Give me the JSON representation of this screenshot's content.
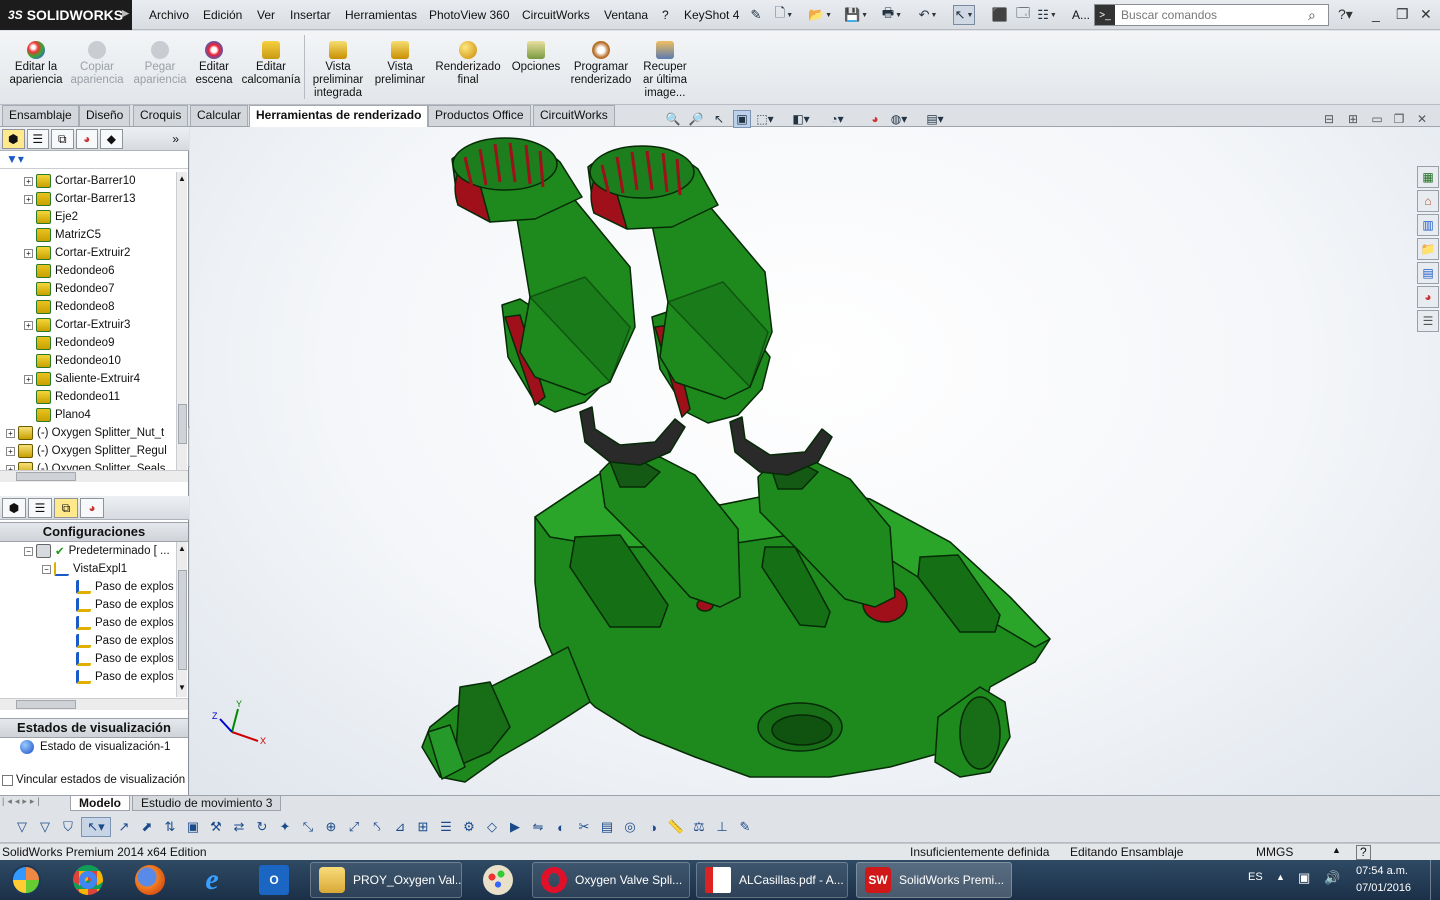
{
  "app": {
    "logo": "SOLIDWORKS",
    "logo_prefix": "3S"
  },
  "menu": [
    "Archivo",
    "Edición",
    "Ver",
    "Insertar",
    "Herramientas",
    "PhotoView 360",
    "CircuitWorks",
    "Ventana",
    "?",
    "KeyShot 4"
  ],
  "search": {
    "placeholder": "Buscar comandos",
    "truncated_label": "A..."
  },
  "ribbon": [
    {
      "label1": "Editar la",
      "label2": "apariencia",
      "label3": "",
      "disabled": false,
      "color": "#d23a2a"
    },
    {
      "label1": "Copiar",
      "label2": "apariencia",
      "label3": "",
      "disabled": true,
      "color": "#b8bcc0"
    },
    {
      "label1": "Pegar",
      "label2": "apariencia",
      "label3": "",
      "disabled": true,
      "color": "#b8bcc0"
    },
    {
      "label1": "Editar",
      "label2": "escena",
      "label3": "",
      "disabled": false,
      "color": "#3a7bd5"
    },
    {
      "label1": "Editar",
      "label2": "calcomanía",
      "label3": "",
      "disabled": false,
      "color": "#e2a400"
    },
    {
      "label1": "Vista",
      "label2": "preliminar",
      "label3": "integrada",
      "disabled": false,
      "color": "#d9a200"
    },
    {
      "label1": "Vista",
      "label2": "preliminar",
      "label3": "",
      "disabled": false,
      "color": "#d9a200"
    },
    {
      "label1": "Renderizado",
      "label2": "final",
      "label3": "",
      "disabled": false,
      "color": "#c98a00"
    },
    {
      "label1": "Opciones",
      "label2": "",
      "label3": "",
      "disabled": false,
      "color": "#7a9a40"
    },
    {
      "label1": "Programar",
      "label2": "renderizado",
      "label3": "",
      "disabled": false,
      "color": "#b7702a"
    },
    {
      "label1": "Recuper",
      "label2": "ar última",
      "label3": "image...",
      "disabled": false,
      "color": "#5a7ab0"
    }
  ],
  "tabs": [
    "Ensamblaje",
    "Diseño",
    "Croquis",
    "Calcular",
    "Herramientas de renderizado",
    "Productos Office",
    "CircuitWorks"
  ],
  "active_tab": "Herramientas de renderizado",
  "tree": [
    {
      "label": "Cortar-Barrer10",
      "expand": true
    },
    {
      "label": "Cortar-Barrer13",
      "expand": true
    },
    {
      "label": "Eje2",
      "expand": false
    },
    {
      "label": "MatrizC5",
      "expand": false
    },
    {
      "label": "Cortar-Extruir2",
      "expand": true
    },
    {
      "label": "Redondeo6",
      "expand": false
    },
    {
      "label": "Redondeo7",
      "expand": false
    },
    {
      "label": "Redondeo8",
      "expand": false
    },
    {
      "label": "Cortar-Extruir3",
      "expand": true
    },
    {
      "label": "Redondeo9",
      "expand": false
    },
    {
      "label": "Redondeo10",
      "expand": false
    },
    {
      "label": "Saliente-Extruir4",
      "expand": true
    },
    {
      "label": "Redondeo11",
      "expand": false
    },
    {
      "label": "Plano4",
      "expand": false
    }
  ],
  "tree_components": [
    "(-) Oxygen Splitter_Nut_t",
    "(-) Oxygen Splitter_Regul",
    "(-) Oxygen Splitter_Seals"
  ],
  "config": {
    "title": "Configuraciones",
    "root": "Predeterminado [ ...",
    "explode": "VistaExpl1",
    "steps": [
      "Paso de explos",
      "Paso de explos",
      "Paso de explos",
      "Paso de explos",
      "Paso de explos",
      "Paso de explos"
    ]
  },
  "display_states": {
    "title": "Estados de visualización",
    "item": "Estado de visualización-1",
    "checkbox": "Vincular estados de visualización"
  },
  "axes": {
    "x": "X",
    "y": "Y",
    "z": "Z"
  },
  "bottom_tabs": [
    "Modelo",
    "Estudio de movimiento 3"
  ],
  "status": {
    "edition": "SolidWorks Premium 2014 x64 Edition",
    "def": "Insuficientemente definida",
    "mode": "Editando Ensamblaje",
    "units": "MMGS",
    "help": "?"
  },
  "taskbar": {
    "items": [
      "PROY_Oxygen Val...",
      "Oxygen Valve Spli...",
      "ALCasillas.pdf - A...",
      "SolidWorks Premi..."
    ],
    "lang": "ES",
    "time": "07:54 a.m.",
    "date": "07/01/2016"
  },
  "colors": {
    "part_green": "#1e8a1e",
    "part_dark": "#0b3d0b",
    "part_red": "#a0101a",
    "gasket": "#2a2a2a"
  }
}
